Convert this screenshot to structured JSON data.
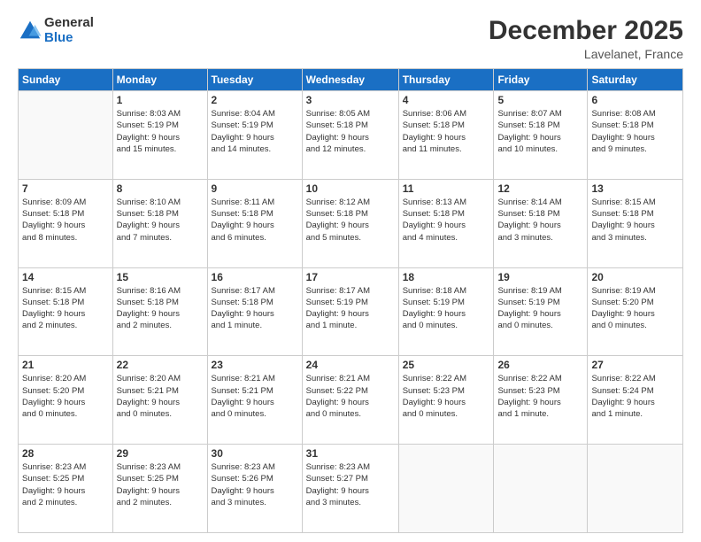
{
  "logo": {
    "general": "General",
    "blue": "Blue"
  },
  "header": {
    "month": "December 2025",
    "location": "Lavelanet, France"
  },
  "weekdays": [
    "Sunday",
    "Monday",
    "Tuesday",
    "Wednesday",
    "Thursday",
    "Friday",
    "Saturday"
  ],
  "weeks": [
    [
      {
        "num": "",
        "detail": ""
      },
      {
        "num": "1",
        "detail": "Sunrise: 8:03 AM\nSunset: 5:19 PM\nDaylight: 9 hours\nand 15 minutes."
      },
      {
        "num": "2",
        "detail": "Sunrise: 8:04 AM\nSunset: 5:19 PM\nDaylight: 9 hours\nand 14 minutes."
      },
      {
        "num": "3",
        "detail": "Sunrise: 8:05 AM\nSunset: 5:18 PM\nDaylight: 9 hours\nand 12 minutes."
      },
      {
        "num": "4",
        "detail": "Sunrise: 8:06 AM\nSunset: 5:18 PM\nDaylight: 9 hours\nand 11 minutes."
      },
      {
        "num": "5",
        "detail": "Sunrise: 8:07 AM\nSunset: 5:18 PM\nDaylight: 9 hours\nand 10 minutes."
      },
      {
        "num": "6",
        "detail": "Sunrise: 8:08 AM\nSunset: 5:18 PM\nDaylight: 9 hours\nand 9 minutes."
      }
    ],
    [
      {
        "num": "7",
        "detail": "Sunrise: 8:09 AM\nSunset: 5:18 PM\nDaylight: 9 hours\nand 8 minutes."
      },
      {
        "num": "8",
        "detail": "Sunrise: 8:10 AM\nSunset: 5:18 PM\nDaylight: 9 hours\nand 7 minutes."
      },
      {
        "num": "9",
        "detail": "Sunrise: 8:11 AM\nSunset: 5:18 PM\nDaylight: 9 hours\nand 6 minutes."
      },
      {
        "num": "10",
        "detail": "Sunrise: 8:12 AM\nSunset: 5:18 PM\nDaylight: 9 hours\nand 5 minutes."
      },
      {
        "num": "11",
        "detail": "Sunrise: 8:13 AM\nSunset: 5:18 PM\nDaylight: 9 hours\nand 4 minutes."
      },
      {
        "num": "12",
        "detail": "Sunrise: 8:14 AM\nSunset: 5:18 PM\nDaylight: 9 hours\nand 3 minutes."
      },
      {
        "num": "13",
        "detail": "Sunrise: 8:15 AM\nSunset: 5:18 PM\nDaylight: 9 hours\nand 3 minutes."
      }
    ],
    [
      {
        "num": "14",
        "detail": "Sunrise: 8:15 AM\nSunset: 5:18 PM\nDaylight: 9 hours\nand 2 minutes."
      },
      {
        "num": "15",
        "detail": "Sunrise: 8:16 AM\nSunset: 5:18 PM\nDaylight: 9 hours\nand 2 minutes."
      },
      {
        "num": "16",
        "detail": "Sunrise: 8:17 AM\nSunset: 5:18 PM\nDaylight: 9 hours\nand 1 minute."
      },
      {
        "num": "17",
        "detail": "Sunrise: 8:17 AM\nSunset: 5:19 PM\nDaylight: 9 hours\nand 1 minute."
      },
      {
        "num": "18",
        "detail": "Sunrise: 8:18 AM\nSunset: 5:19 PM\nDaylight: 9 hours\nand 0 minutes."
      },
      {
        "num": "19",
        "detail": "Sunrise: 8:19 AM\nSunset: 5:19 PM\nDaylight: 9 hours\nand 0 minutes."
      },
      {
        "num": "20",
        "detail": "Sunrise: 8:19 AM\nSunset: 5:20 PM\nDaylight: 9 hours\nand 0 minutes."
      }
    ],
    [
      {
        "num": "21",
        "detail": "Sunrise: 8:20 AM\nSunset: 5:20 PM\nDaylight: 9 hours\nand 0 minutes."
      },
      {
        "num": "22",
        "detail": "Sunrise: 8:20 AM\nSunset: 5:21 PM\nDaylight: 9 hours\nand 0 minutes."
      },
      {
        "num": "23",
        "detail": "Sunrise: 8:21 AM\nSunset: 5:21 PM\nDaylight: 9 hours\nand 0 minutes."
      },
      {
        "num": "24",
        "detail": "Sunrise: 8:21 AM\nSunset: 5:22 PM\nDaylight: 9 hours\nand 0 minutes."
      },
      {
        "num": "25",
        "detail": "Sunrise: 8:22 AM\nSunset: 5:23 PM\nDaylight: 9 hours\nand 0 minutes."
      },
      {
        "num": "26",
        "detail": "Sunrise: 8:22 AM\nSunset: 5:23 PM\nDaylight: 9 hours\nand 1 minute."
      },
      {
        "num": "27",
        "detail": "Sunrise: 8:22 AM\nSunset: 5:24 PM\nDaylight: 9 hours\nand 1 minute."
      }
    ],
    [
      {
        "num": "28",
        "detail": "Sunrise: 8:23 AM\nSunset: 5:25 PM\nDaylight: 9 hours\nand 2 minutes."
      },
      {
        "num": "29",
        "detail": "Sunrise: 8:23 AM\nSunset: 5:25 PM\nDaylight: 9 hours\nand 2 minutes."
      },
      {
        "num": "30",
        "detail": "Sunrise: 8:23 AM\nSunset: 5:26 PM\nDaylight: 9 hours\nand 3 minutes."
      },
      {
        "num": "31",
        "detail": "Sunrise: 8:23 AM\nSunset: 5:27 PM\nDaylight: 9 hours\nand 3 minutes."
      },
      {
        "num": "",
        "detail": ""
      },
      {
        "num": "",
        "detail": ""
      },
      {
        "num": "",
        "detail": ""
      }
    ]
  ]
}
